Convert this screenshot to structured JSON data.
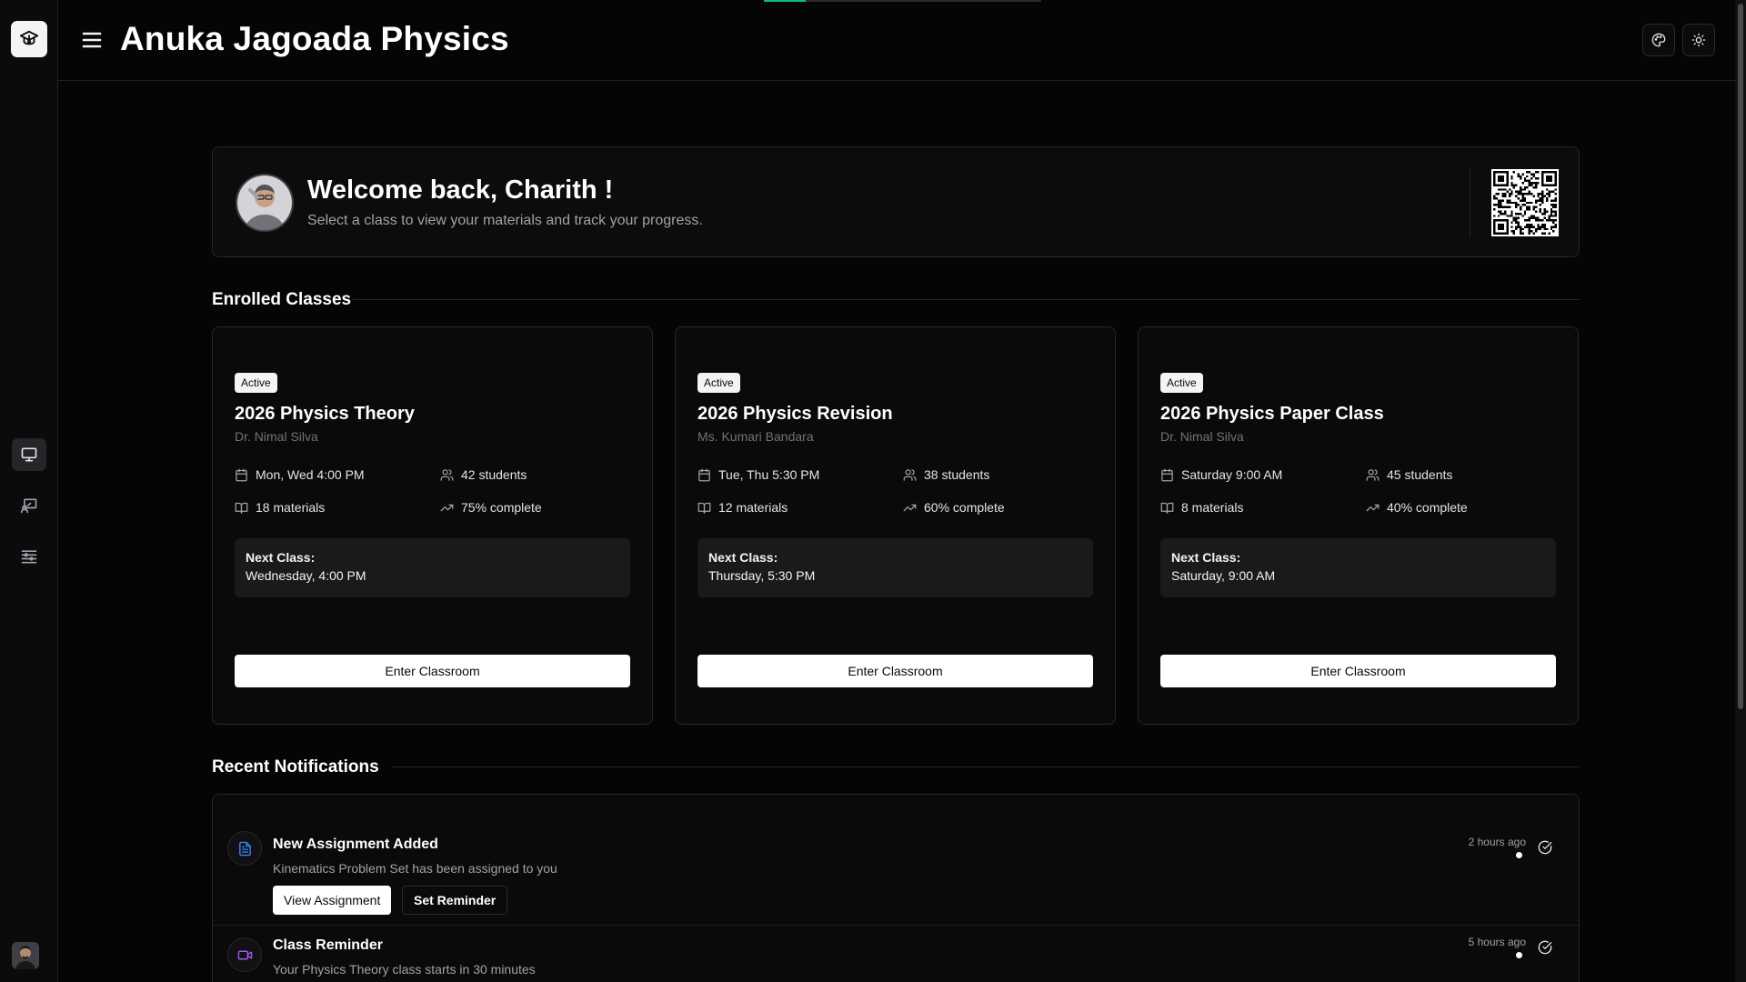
{
  "app": {
    "title": "Anuka Jagoada Physics",
    "loading_progress": 0.15
  },
  "sidebar": {
    "logo_icon": "graduation-cap-icon",
    "items": [
      {
        "icon": "monitor-icon",
        "active": true
      },
      {
        "icon": "presentation-icon",
        "active": false
      },
      {
        "icon": "settings-sliders-icon",
        "active": false
      }
    ]
  },
  "header": {
    "menu_icon": "hamburger-menu-icon",
    "buttons": [
      {
        "icon": "palette-icon"
      },
      {
        "icon": "sun-icon"
      }
    ]
  },
  "welcome": {
    "title": "Welcome back, Charith !",
    "subtitle": "Select a class to view your materials and track your progress."
  },
  "enrolled": {
    "heading": "Enrolled Classes",
    "classes": [
      {
        "status": "Active",
        "title": "2026 Physics Theory",
        "teacher": "Dr. Nimal Silva",
        "schedule": "Mon, Wed 4:00 PM",
        "students": "42 students",
        "materials": "18 materials",
        "progress": "75% complete",
        "next_label": "Next Class:",
        "next_value": "Wednesday, 4:00 PM",
        "button": "Enter Classroom"
      },
      {
        "status": "Active",
        "title": "2026 Physics Revision",
        "teacher": "Ms. Kumari Bandara",
        "schedule": "Tue, Thu 5:30 PM",
        "students": "38 students",
        "materials": "12 materials",
        "progress": "60% complete",
        "next_label": "Next Class:",
        "next_value": "Thursday, 5:30 PM",
        "button": "Enter Classroom"
      },
      {
        "status": "Active",
        "title": "2026 Physics Paper Class",
        "teacher": "Dr. Nimal Silva",
        "schedule": "Saturday 9:00 AM",
        "students": "45 students",
        "materials": "8 materials",
        "progress": "40% complete",
        "next_label": "Next Class:",
        "next_value": "Saturday, 9:00 AM",
        "button": "Enter Classroom"
      }
    ]
  },
  "notifications": {
    "heading": "Recent Notifications",
    "items": [
      {
        "icon": "document-icon",
        "icon_color": "#3b82f6",
        "title": "New Assignment Added",
        "body": "Kinematics Problem Set has been assigned to you",
        "time": "2 hours ago",
        "primary_action": "View Assignment",
        "secondary_action": "Set Reminder"
      },
      {
        "icon": "video-icon",
        "icon_color": "#a855f7",
        "title": "Class Reminder",
        "body": "Your Physics Theory class starts in 30 minutes",
        "time": "5 hours ago"
      }
    ]
  }
}
